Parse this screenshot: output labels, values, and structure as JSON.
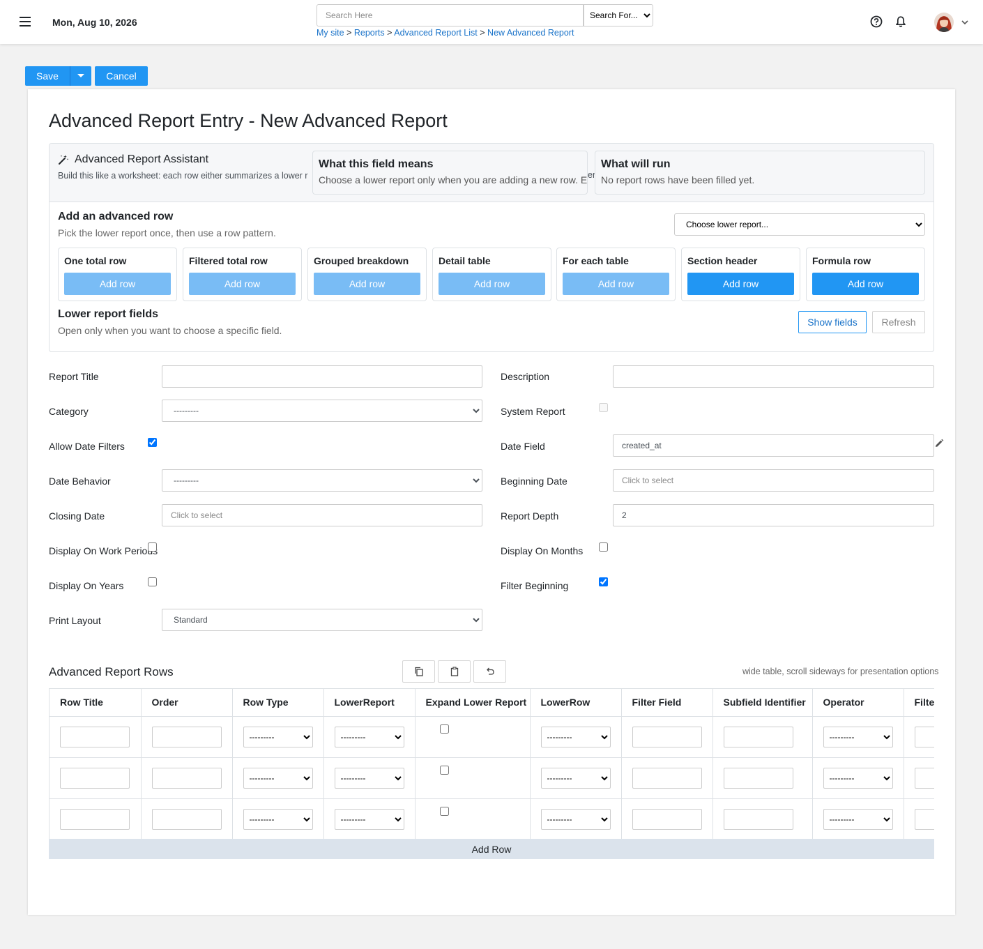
{
  "topbar": {
    "date": "Mon, Aug 10, 2026",
    "search_placeholder": "Search Here",
    "search_select_value": "Search For...",
    "breadcrumb": [
      "My site",
      "Reports",
      "Advanced Report List",
      "New Advanced Report"
    ],
    "breadcrumb_sep": ">"
  },
  "actions": {
    "save_label": "Save",
    "cancel_label": "Cancel"
  },
  "page": {
    "title": "Advanced Report Entry - New Advanced Report"
  },
  "assistant": {
    "title": "Advanced Report Assistant",
    "description": "Build this like a worksheet: each row either summarizes a lower r",
    "spill_text": "er",
    "meaning_title": "What this field means",
    "meaning_text": "Choose a lower report only when you are adding a new row. Ex",
    "run_title": "What will run",
    "run_text": "No report rows have been filled yet.",
    "add_title": "Add an advanced row",
    "add_desc": "Pick the lower report once, then use a row pattern.",
    "lower_report_select": "Choose lower report...",
    "patterns": [
      {
        "title": "One total row",
        "button": "Add row",
        "enabled": false
      },
      {
        "title": "Filtered total row",
        "button": "Add row",
        "enabled": false
      },
      {
        "title": "Grouped breakdown",
        "button": "Add row",
        "enabled": false
      },
      {
        "title": "Detail table",
        "button": "Add row",
        "enabled": false
      },
      {
        "title": "For each table",
        "button": "Add row",
        "enabled": false
      },
      {
        "title": "Section header",
        "button": "Add row",
        "enabled": true
      },
      {
        "title": "Formula row",
        "button": "Add row",
        "enabled": true
      }
    ],
    "lower_fields_title": "Lower report fields",
    "lower_fields_desc": "Open only when you want to choose a specific field.",
    "show_fields_label": "Show fields",
    "refresh_label": "Refresh"
  },
  "form": {
    "report_title_label": "Report Title",
    "description_label": "Description",
    "category_label": "Category",
    "category_value": "---------",
    "system_report_label": "System Report",
    "allow_date_filters_label": "Allow Date Filters",
    "allow_date_filters_checked": true,
    "date_field_label": "Date Field",
    "date_field_value": "created_at",
    "date_behavior_label": "Date Behavior",
    "date_behavior_value": "---------",
    "beginning_date_label": "Beginning Date",
    "beginning_date_placeholder": "Click to select",
    "closing_date_label": "Closing Date",
    "closing_date_placeholder": "Click to select",
    "report_depth_label": "Report Depth",
    "report_depth_value": "2",
    "display_work_periods_label": "Display On Work Periods",
    "display_months_label": "Display On Months",
    "display_years_label": "Display On Years",
    "filter_beginning_label": "Filter Beginning",
    "filter_beginning_checked": true,
    "print_layout_label": "Print Layout",
    "print_layout_value": "Standard"
  },
  "rows_section": {
    "title": "Advanced Report Rows",
    "hint": "wide table, scroll sideways for presentation options",
    "columns": [
      "Row Title",
      "Order",
      "Row Type",
      "LowerReport",
      "Expand Lower Report",
      "LowerRow",
      "Filter Field",
      "Subfield Identifier",
      "Operator",
      "Filter"
    ],
    "select_placeholder": "---------",
    "add_row_label": "Add Row"
  },
  "colors": {
    "accent": "#2196f3",
    "accent_disabled": "#79bcf5",
    "link": "#1a73c9",
    "add_row_bg": "#dbe3ec"
  }
}
